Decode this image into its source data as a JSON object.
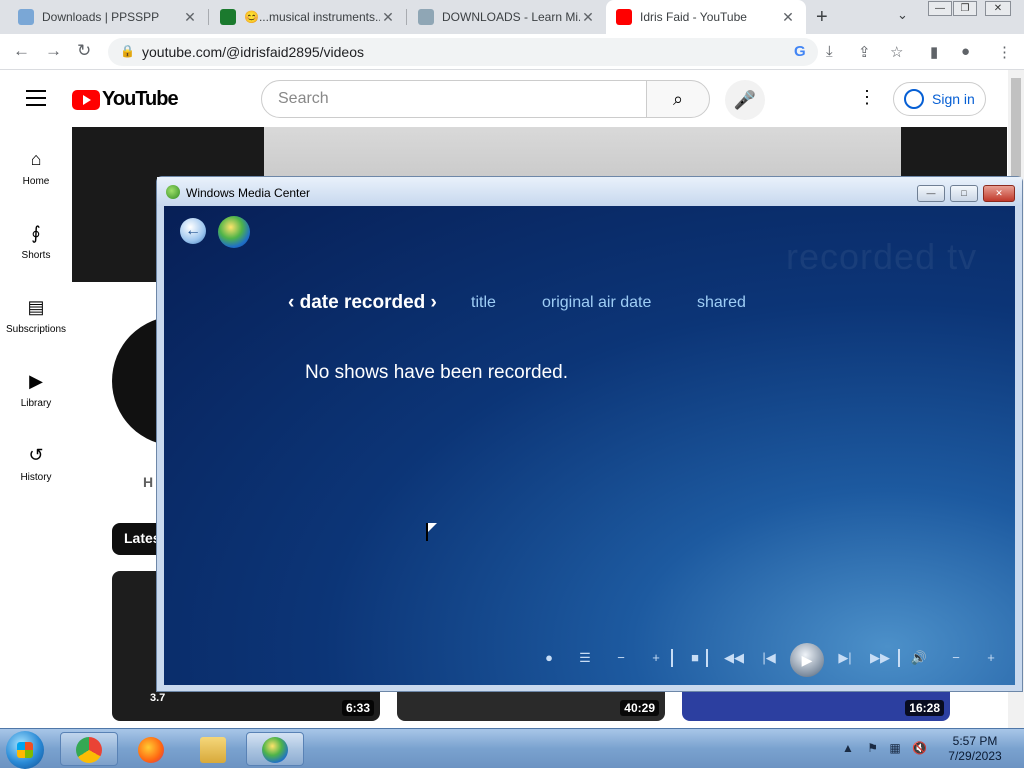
{
  "browser": {
    "tabs": [
      {
        "title": "Downloads | PPSSPP",
        "active": false
      },
      {
        "title": "😊...musical instruments...",
        "active": false
      },
      {
        "title": "DOWNLOADS - Learn Mi...",
        "active": false
      },
      {
        "title": "Idris Faid - YouTube",
        "active": true
      }
    ],
    "url": "youtube.com/@idrisfaid2895/videos"
  },
  "youtube": {
    "logo_text": "YouTube",
    "search_placeholder": "Search",
    "signin_label": "Sign in",
    "sidebar": [
      {
        "label": "Home",
        "icon": "home-icon"
      },
      {
        "label": "Shorts",
        "icon": "shorts-icon"
      },
      {
        "label": "Subscriptions",
        "icon": "subscriptions-icon"
      },
      {
        "label": "Library",
        "icon": "library-icon"
      },
      {
        "label": "History",
        "icon": "history-icon"
      }
    ],
    "channel_initial": "H",
    "chip_label": "Lates",
    "videos": [
      {
        "duration": "6:33",
        "overlay": "3.7"
      },
      {
        "duration": "40:29"
      },
      {
        "duration": "16:28"
      }
    ]
  },
  "media_center": {
    "window_title": "Windows Media Center",
    "watermark": "recorded tv",
    "pivots": {
      "selected": "date recorded",
      "others": [
        "title",
        "original air date",
        "shared"
      ]
    },
    "empty_message": "No shows have been recorded."
  },
  "taskbar": {
    "time": "5:57 PM",
    "date": "7/29/2023"
  }
}
